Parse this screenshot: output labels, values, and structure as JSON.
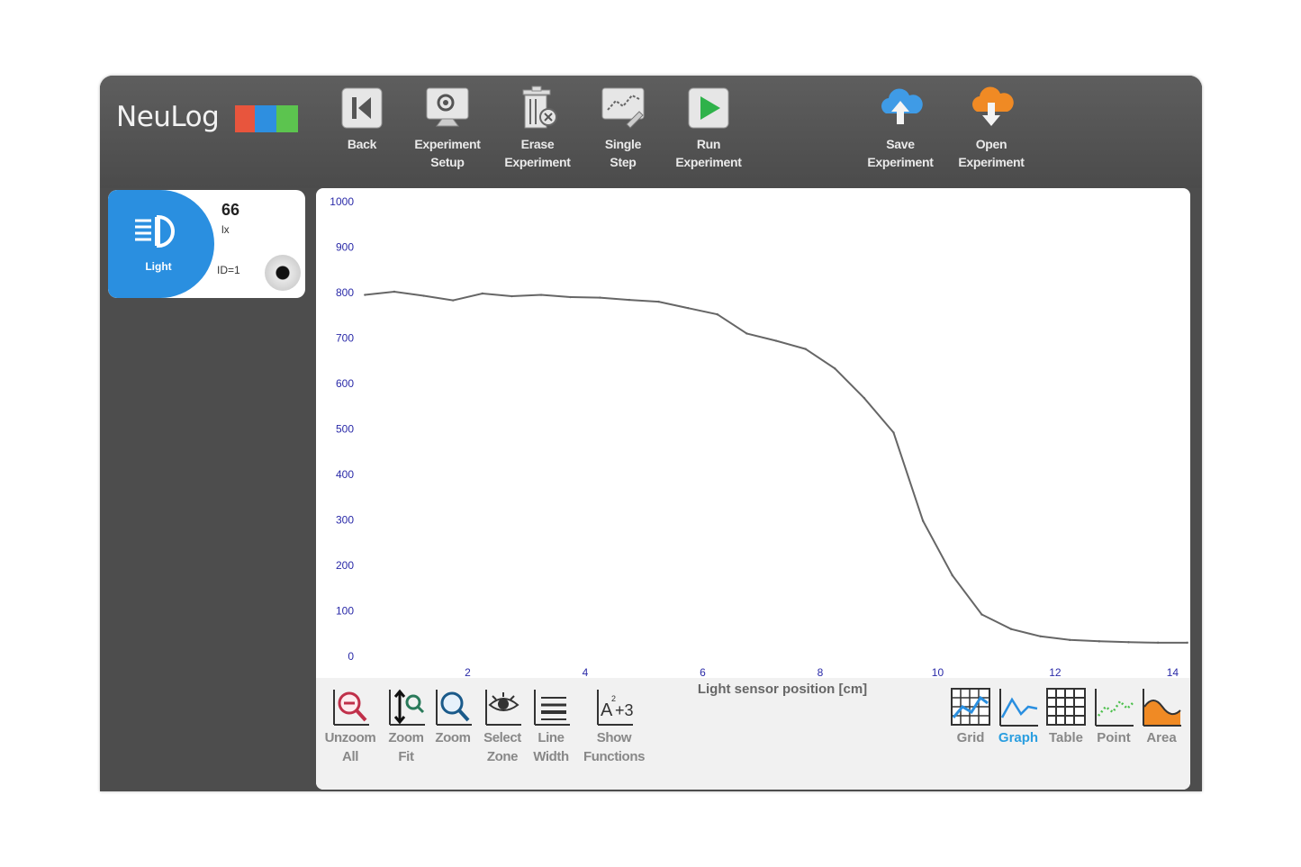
{
  "app": {
    "logo_text": "NeuLog"
  },
  "toolbar": [
    {
      "label": "Back",
      "icon": "back-icon"
    },
    {
      "label": "Experiment\nSetup",
      "icon": "experiment-setup-icon"
    },
    {
      "label": "Erase\nExperiment",
      "icon": "erase-icon"
    },
    {
      "label": "Single\nStep",
      "icon": "single-step-icon"
    },
    {
      "label": "Run\nExperiment",
      "icon": "run-icon"
    },
    {
      "label": "Save\nExperiment",
      "icon": "cloud-upload-icon"
    },
    {
      "label": "Open\nExperiment",
      "icon": "cloud-download-icon"
    }
  ],
  "sensor": {
    "name": "Light",
    "value": "66",
    "unit": "lx",
    "id": "ID=1",
    "icon": "light-icon"
  },
  "bottom_tools": [
    {
      "label": "Unzoom\nAll",
      "icon": "unzoom-icon"
    },
    {
      "label": "Zoom\nFit",
      "icon": "zoom-fit-icon"
    },
    {
      "label": "Zoom",
      "icon": "zoom-icon"
    },
    {
      "label": "Select\nZone",
      "icon": "eye-icon"
    },
    {
      "label": "Line\nWidth",
      "icon": "line-width-icon"
    },
    {
      "label": "Show\nFunctions",
      "icon": "functions-icon"
    }
  ],
  "view_modes": [
    {
      "label": "Grid",
      "icon": "grid-icon",
      "active": false
    },
    {
      "label": "Graph",
      "icon": "graph-icon",
      "active": true
    },
    {
      "label": "Table",
      "icon": "table-icon",
      "active": false
    },
    {
      "label": "Point",
      "icon": "point-icon",
      "active": false
    },
    {
      "label": "Area",
      "icon": "area-icon",
      "active": false
    }
  ],
  "colors": {
    "accent": "#2a8fe0",
    "toolbar_bg": "#4d4d4d",
    "line": "#666666",
    "tick_label": "#2a2aa8"
  },
  "chart_data": {
    "type": "line",
    "xlabel": "Light sensor position [cm]",
    "ylabel": "",
    "xlim": [
      0,
      14.3
    ],
    "ylim": [
      0,
      1000
    ],
    "x_ticks": [
      2,
      4,
      6,
      8,
      10,
      12,
      14
    ],
    "y_ticks": [
      0,
      100,
      200,
      300,
      400,
      500,
      600,
      700,
      800,
      900,
      1000
    ],
    "grid": false,
    "series": [
      {
        "x": [
          0.25,
          0.75,
          1.25,
          1.75,
          2.25,
          2.75,
          3.25,
          3.75,
          4.25,
          4.75,
          5.25,
          5.75,
          6.25,
          6.75,
          7.25,
          7.75,
          8.25,
          8.75,
          9.25,
          9.75,
          10.25,
          10.75,
          11.25,
          11.75,
          12.25,
          12.75,
          13.25,
          13.75,
          14.25
        ],
        "y": [
          795,
          802,
          793,
          783,
          798,
          792,
          795,
          790,
          789,
          784,
          780,
          766,
          752,
          710,
          694,
          676,
          633,
          568,
          492,
          298,
          178,
          92,
          60,
          44,
          36,
          33,
          31,
          30,
          30
        ]
      }
    ]
  }
}
